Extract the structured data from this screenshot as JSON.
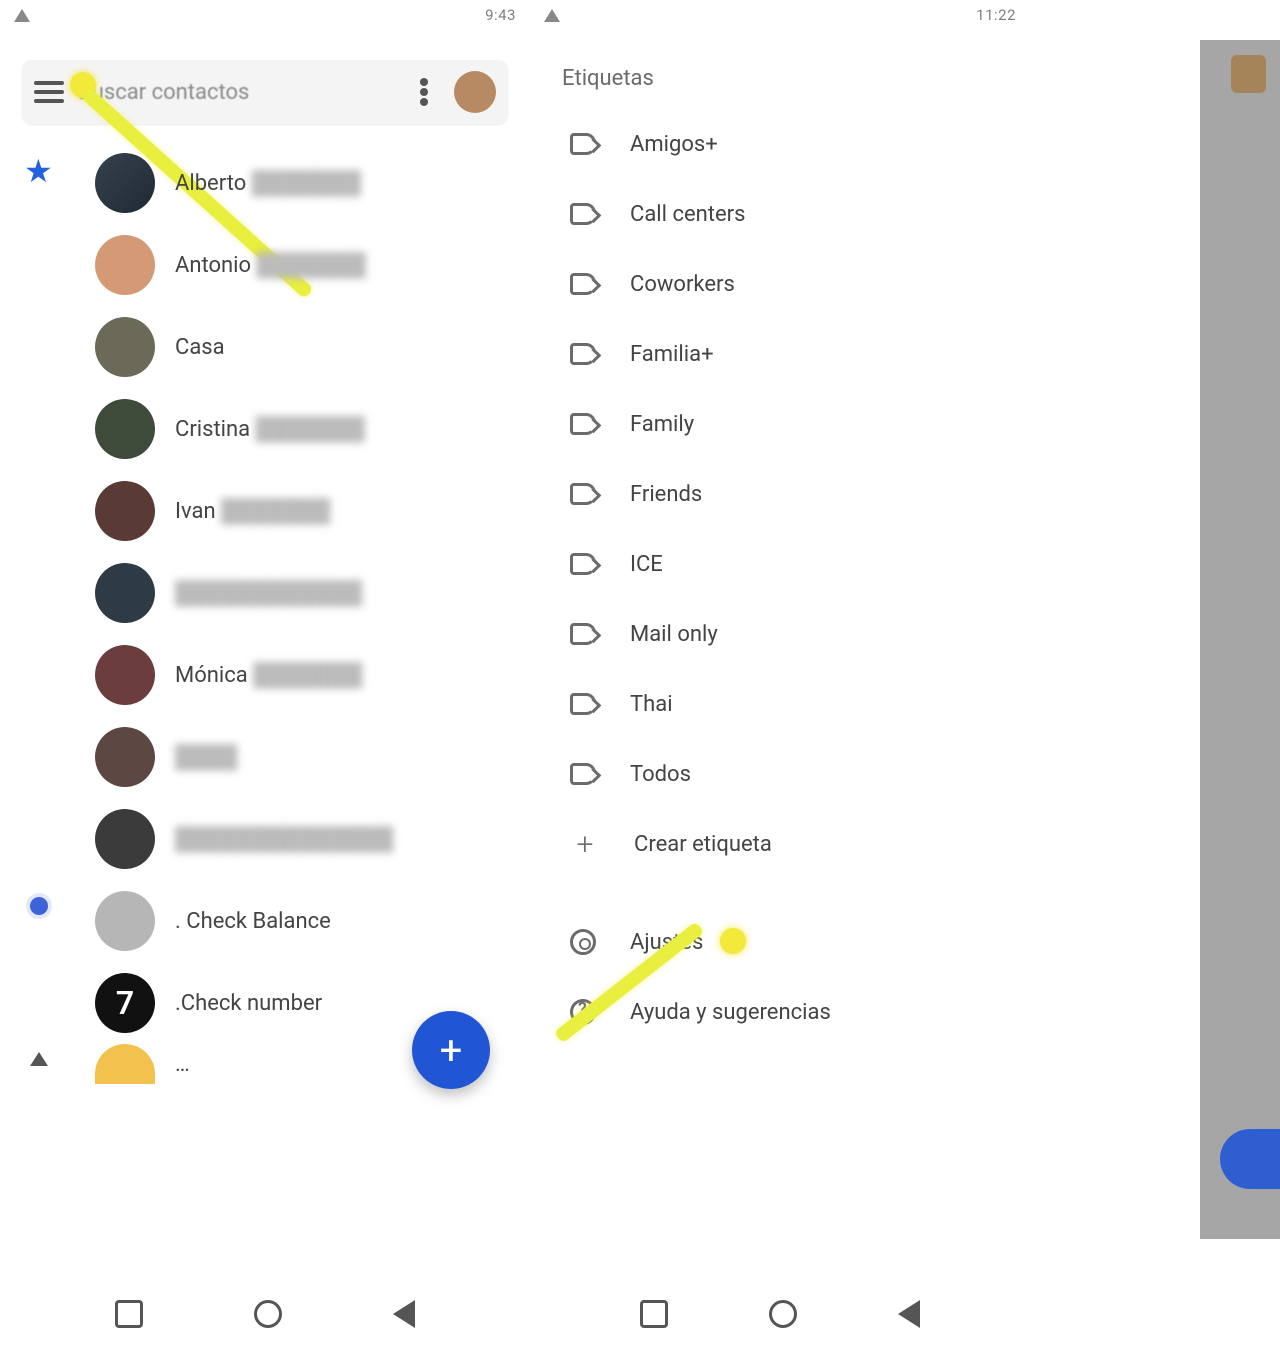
{
  "status_left": {
    "carrier": "",
    "battery": "",
    "time": "9:43"
  },
  "status_mid": {
    "carrier": "",
    "battery": "",
    "time": "11:22"
  },
  "search": {
    "placeholder": "Buscar contactos"
  },
  "starred_indicator": "★",
  "contacts": [
    {
      "name": "Alberto",
      "extra_blurred": true
    },
    {
      "name": "Antonio",
      "extra_blurred": true
    },
    {
      "name": "Casa",
      "extra_blurred": false
    },
    {
      "name": "Cristina",
      "extra_blurred": true
    },
    {
      "name": "Ivan",
      "extra_blurred": true
    },
    {
      "name": "",
      "extra_blurred": true
    },
    {
      "name": "Mónica",
      "extra_blurred": true
    },
    {
      "name": "",
      "extra_blurred": true
    },
    {
      "name": "",
      "extra_blurred": true
    },
    {
      "name": ". Check Balance",
      "extra_blurred": false
    },
    {
      "name": ".Check number",
      "extra_blurred": false
    }
  ],
  "fab_label": "+",
  "labels_section_title": "Etiquetas",
  "labels": [
    "Amigos+",
    "Call centers",
    "Coworkers",
    "Familia+",
    "Family",
    "Friends",
    "ICE",
    "Mail only",
    "Thai",
    "Todos"
  ],
  "create_label": "Crear etiqueta",
  "settings_label": "Ajustes",
  "help_label": "Ayuda y sugerencias",
  "seven": "7"
}
